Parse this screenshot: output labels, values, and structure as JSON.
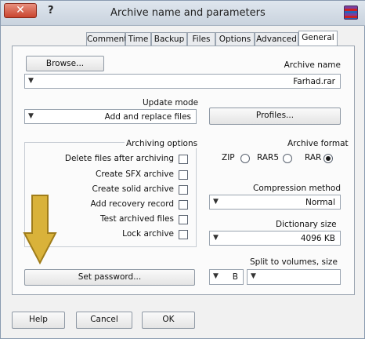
{
  "window": {
    "title": "Archive name and parameters",
    "help_mark": "?",
    "close_glyph": "✕",
    "icon": "winrar-books-icon"
  },
  "tabs": [
    {
      "label": "General",
      "active": true
    },
    {
      "label": "Advanced"
    },
    {
      "label": "Options"
    },
    {
      "label": "Files"
    },
    {
      "label": "Backup"
    },
    {
      "label": "Time"
    },
    {
      "label": "Comment"
    }
  ],
  "archive_name": {
    "label": "Archive name",
    "value": "Farhad.rar",
    "browse_label": "Browse..."
  },
  "update_mode": {
    "label": "Update mode",
    "value": "Add and replace files"
  },
  "profiles_label": "Profiles...",
  "archive_format": {
    "label": "Archive format",
    "options": [
      "RAR",
      "RAR5",
      "ZIP"
    ],
    "selected": "RAR"
  },
  "compression_method": {
    "label": "Compression method",
    "value": "Normal"
  },
  "dictionary_size": {
    "label": "Dictionary size",
    "value": "4096 KB"
  },
  "split_volumes": {
    "label": "Split to volumes, size",
    "unit": "B",
    "value": ""
  },
  "archiving_options": {
    "label": "Archiving options",
    "items": [
      {
        "label": "Delete files after archiving",
        "checked": false
      },
      {
        "label": "Create SFX archive",
        "checked": false
      },
      {
        "label": "Create solid archive",
        "checked": false
      },
      {
        "label": "Add recovery record",
        "checked": false
      },
      {
        "label": "Test archived files",
        "checked": false
      },
      {
        "label": "Lock archive",
        "checked": false
      }
    ]
  },
  "set_password_label": "Set password...",
  "buttons": {
    "ok": "OK",
    "cancel": "Cancel",
    "help": "Help"
  },
  "colors": {
    "annotation_arrow": "#d9b23a"
  }
}
